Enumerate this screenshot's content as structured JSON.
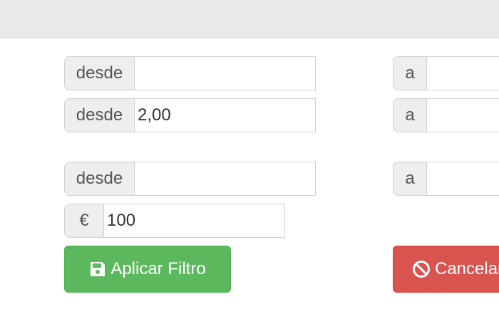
{
  "filters": {
    "row1": {
      "from_label": "desde",
      "from_value": "",
      "to_label": "a",
      "to_value": ""
    },
    "row2": {
      "from_label": "desde",
      "from_value": "2,00",
      "to_label": "a",
      "to_value": ""
    },
    "row3": {
      "from_label": "desde",
      "from_value": "",
      "to_label": "a",
      "to_value": ""
    },
    "price": {
      "currency_label": "€",
      "value": "100"
    }
  },
  "actions": {
    "apply": {
      "label": "Aplicar Filtro",
      "icon": "save-icon"
    },
    "cancel": {
      "label": "Cancelar",
      "icon": "ban-icon"
    }
  },
  "colors": {
    "apply_bg": "#5cb85c",
    "cancel_bg": "#d9534f",
    "addon_bg": "#eeeeee",
    "header_bg": "#e9e9e9"
  }
}
